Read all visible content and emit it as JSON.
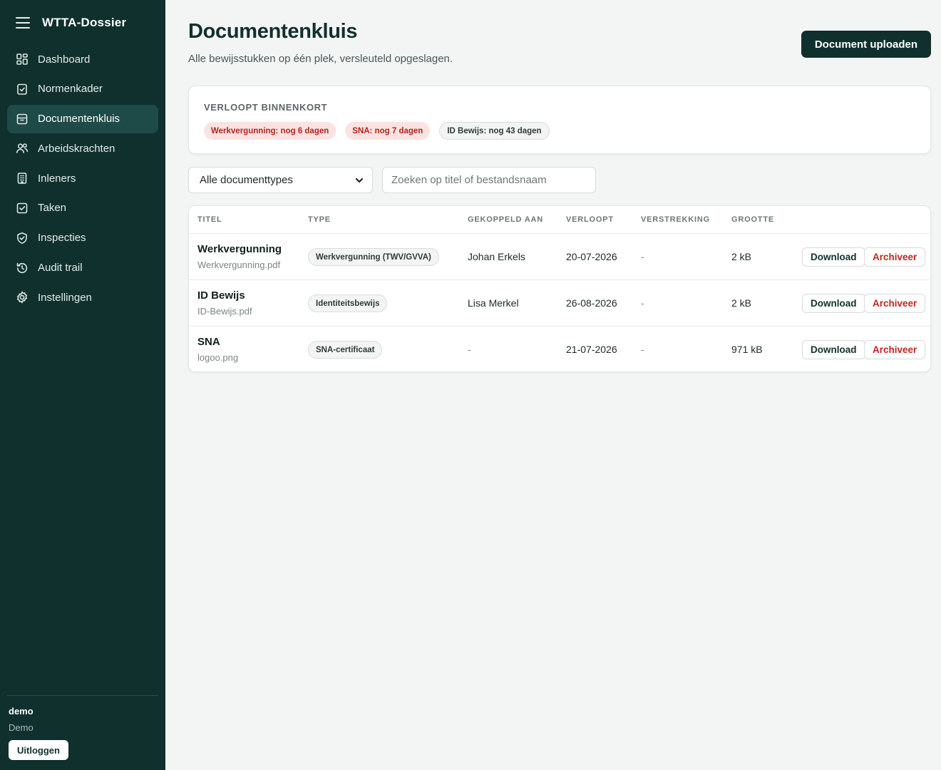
{
  "app": {
    "brand": "WTTA-Dossier"
  },
  "sidebar": {
    "items": [
      {
        "label": "Dashboard",
        "icon": "grid-icon",
        "active": false
      },
      {
        "label": "Normenkader",
        "icon": "clipboard-check-icon",
        "active": false
      },
      {
        "label": "Documentenkluis",
        "icon": "archive-icon",
        "active": true
      },
      {
        "label": "Arbeidskrachten",
        "icon": "users-icon",
        "active": false
      },
      {
        "label": "Inleners",
        "icon": "building-icon",
        "active": false
      },
      {
        "label": "Taken",
        "icon": "checkbox-icon",
        "active": false
      },
      {
        "label": "Inspecties",
        "icon": "shield-check-icon",
        "active": false
      },
      {
        "label": "Audit trail",
        "icon": "history-icon",
        "active": false
      },
      {
        "label": "Instellingen",
        "icon": "gear-icon",
        "active": false
      }
    ],
    "user": {
      "name": "demo",
      "role": "Demo",
      "logout_label": "Uitloggen"
    }
  },
  "header": {
    "title": "Documentenkluis",
    "subtitle": "Alle bewijsstukken op één plek, versleuteld opgeslagen.",
    "upload_label": "Document uploaden"
  },
  "expiring": {
    "heading": "VERLOOPT BINNENKORT",
    "chips": [
      {
        "label": "Werkvergunning: nog 6 dagen",
        "urgent": true
      },
      {
        "label": "SNA: nog 7 dagen",
        "urgent": true
      },
      {
        "label": "ID Bewijs: nog 43 dagen",
        "urgent": false
      }
    ]
  },
  "filters": {
    "type_select_value": "Alle documenttypes",
    "search_placeholder": "Zoeken op titel of bestandsnaam"
  },
  "table": {
    "columns": [
      "TITEL",
      "TYPE",
      "GEKOPPELD AAN",
      "VERLOOPT",
      "VERSTREKKING",
      "GROOTTE"
    ],
    "rows": [
      {
        "title": "Werkvergunning",
        "file": "Werkvergunning.pdf",
        "type": "Werkvergunning (TWV/GVVA)",
        "linked": "Johan Erkels",
        "expires": "20-07-2026",
        "issued": "-",
        "size": "2 kB"
      },
      {
        "title": "ID Bewijs",
        "file": "ID-Bewijs.pdf",
        "type": "Identiteitsbewijs",
        "linked": "Lisa Merkel",
        "expires": "26-08-2026",
        "issued": "-",
        "size": "2 kB"
      },
      {
        "title": "SNA",
        "file": "logoo.png",
        "type": "SNA-certificaat",
        "linked": "-",
        "expires": "21-07-2026",
        "issued": "-",
        "size": "971 kB"
      }
    ],
    "download_label": "Download",
    "archive_label": "Archiveer"
  },
  "colors": {
    "sidebar_bg": "#10302d",
    "active_nav": "#1e4a47",
    "primary": "#10302d",
    "danger": "#c0261f",
    "urgent_chip_bg": "#fde2e2"
  }
}
